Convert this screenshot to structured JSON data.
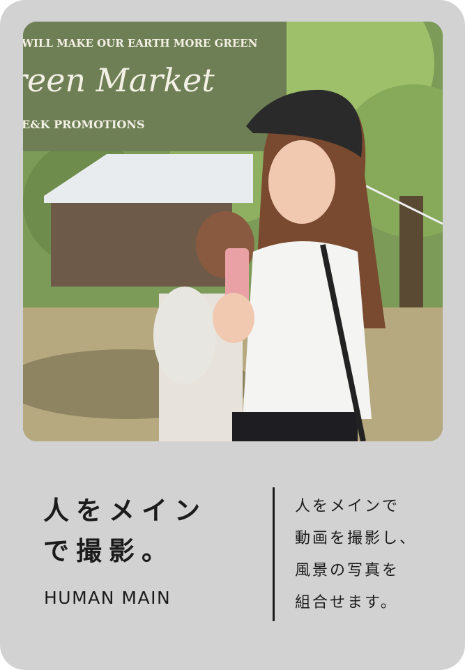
{
  "photo": {
    "banner_top_line": "WILL MAKE OUR EARTH MORE GREEN",
    "banner_main": "reen Market",
    "banner_bottom": "E&K PROMOTIONS"
  },
  "heading": {
    "line1": "人をメイン",
    "line2": "で撮影。",
    "english": "HUMAN MAIN"
  },
  "description": {
    "lines": [
      "人をメインで",
      "動画を撮影し、",
      "風景の写真を",
      "組合せます。"
    ]
  },
  "colors": {
    "card_background": "#d2d2d2",
    "text": "#1b1b1b",
    "banner_green": "#6f7f55"
  }
}
